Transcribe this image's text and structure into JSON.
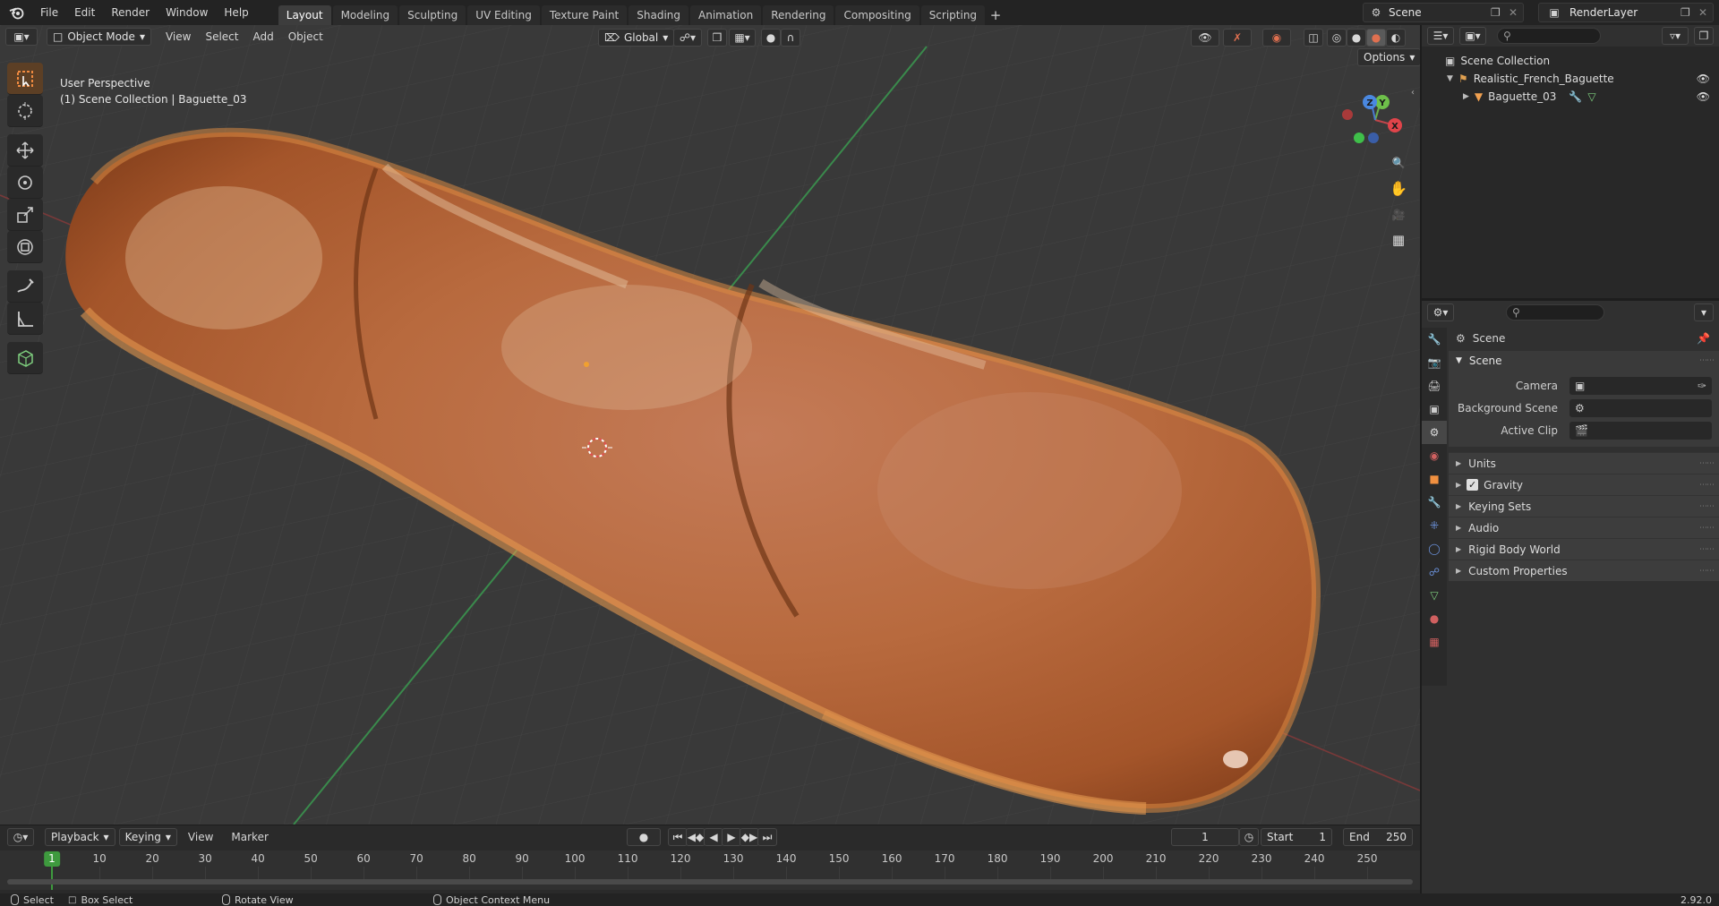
{
  "topbar": {
    "menus": [
      "File",
      "Edit",
      "Render",
      "Window",
      "Help"
    ],
    "workspaces": [
      "Layout",
      "Modeling",
      "Sculpting",
      "UV Editing",
      "Texture Paint",
      "Shading",
      "Animation",
      "Rendering",
      "Compositing",
      "Scripting"
    ],
    "active_workspace": "Layout",
    "add_tab": "+",
    "scene_name": "Scene",
    "view_layer": "RenderLayer"
  },
  "viewport": {
    "mode": "Object Mode",
    "menus": [
      "View",
      "Select",
      "Add",
      "Object"
    ],
    "transform_orientation": "Global",
    "options_label": "Options",
    "info_line1": "User Perspective",
    "info_line2": "(1) Scene Collection | Baguette_03",
    "gizmo_axes": {
      "x": "X",
      "y": "Y",
      "z": "Z"
    }
  },
  "outliner": {
    "root": "Scene Collection",
    "collection": "Realistic_French_Baguette",
    "object": "Baguette_03"
  },
  "properties": {
    "context_title": "Scene",
    "panel_title": "Scene",
    "rows": [
      {
        "label": "Camera"
      },
      {
        "label": "Background Scene"
      },
      {
        "label": "Active Clip"
      }
    ],
    "subpanels": [
      "Units",
      "Gravity",
      "Keying Sets",
      "Audio",
      "Rigid Body World",
      "Custom Properties"
    ],
    "gravity_checked": true
  },
  "timeline": {
    "menus": [
      "Playback",
      "Keying",
      "View",
      "Marker"
    ],
    "current_frame": "1",
    "start_label": "Start",
    "start": "1",
    "end_label": "End",
    "end": "250",
    "ruler_ticks": [
      "10",
      "20",
      "30",
      "40",
      "50",
      "60",
      "70",
      "80",
      "90",
      "100",
      "110",
      "120",
      "130",
      "140",
      "150",
      "160",
      "170",
      "180",
      "190",
      "200",
      "210",
      "220",
      "230",
      "240",
      "250"
    ],
    "marker_frame": "1"
  },
  "statusbar": {
    "select": "Select",
    "box_select": "Box Select",
    "rotate_view": "Rotate View",
    "context_menu": "Object Context Menu",
    "version": "2.92.0"
  },
  "colors": {
    "accent_orange": "#e0773a",
    "frame_green": "#3e9a3e",
    "axis_red": "#b03a3a",
    "axis_green": "#3a9a3a"
  }
}
